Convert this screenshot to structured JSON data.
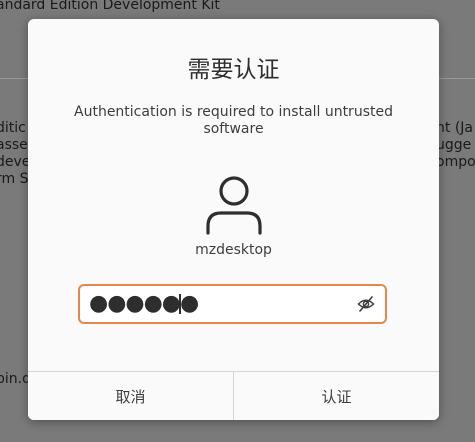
{
  "background_window": {
    "title": "andard Edition Development Kit",
    "left_lines": [
      "ditic",
      "asse",
      "deve",
      "rm S"
    ],
    "right_lines": [
      "nt (Ja",
      "ugge",
      "ompo"
    ],
    "bottom_line": "bin.d"
  },
  "dialog": {
    "title": "需要认证",
    "message": "Authentication is required to install untrusted software",
    "user": {
      "avatar_icon": "user-icon",
      "name": "mzdesktop"
    },
    "password": {
      "masked_value": "●●●●●●",
      "toggle_icon": "eye-slash-icon"
    },
    "buttons": {
      "cancel": "取消",
      "authenticate": "认证"
    }
  },
  "colors": {
    "focus_border": "#e9864a",
    "dialog_bg": "#fafafa",
    "backdrop": "#7a7a7a"
  }
}
